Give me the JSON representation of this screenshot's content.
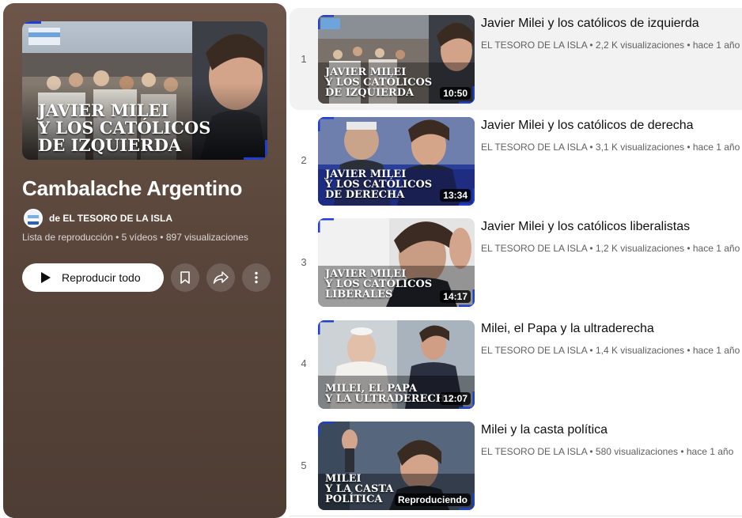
{
  "playlist": {
    "title": "Cambalache Argentino",
    "channel": "de EL TESORO DE LA ISLA",
    "meta": "Lista de reproducción • 5 vídeos • 897 visualizaciones",
    "hero_caption": [
      "JAVIER MILEI",
      "Y LOS CATÓLICOS",
      "DE IZQUIERDA"
    ],
    "play_all_label": "Reproducir todo"
  },
  "colors": {
    "panel": "#5a463b",
    "accent_blue": "#1e3fd0"
  },
  "videos": [
    {
      "index": "1",
      "title": "Javier Milei y los católicos de izquierda",
      "meta": "EL TESORO DE LA ISLA • 2,2 K visualizaciones • hace 1 año",
      "duration": "10:50",
      "caption": [
        "JAVIER MILEI",
        "Y LOS CATÓLICOS",
        "DE IZQUIERDA"
      ]
    },
    {
      "index": "2",
      "title": "Javier Milei y los católicos de derecha",
      "meta": "EL TESORO DE LA ISLA • 3,1 K visualizaciones • hace 1 año",
      "duration": "13:34",
      "caption": [
        "JAVIER MILEI",
        "Y LOS CATÓLICOS",
        "DE DERECHA"
      ]
    },
    {
      "index": "3",
      "title": "Javier Milei y los católicos liberalistas",
      "meta": "EL TESORO DE LA ISLA • 1,2 K visualizaciones • hace 1 año",
      "duration": "14:17",
      "caption": [
        "JAVIER MILEI",
        "Y LOS CATÓLICOS",
        "LIBERALES"
      ]
    },
    {
      "index": "4",
      "title": "Milei, el Papa y la ultraderecha",
      "meta": "EL TESORO DE LA ISLA • 1,4 K visualizaciones • hace 1 año",
      "duration": "12:07",
      "caption": [
        "MILEI, EL PAPA",
        "Y LA ULTRADERECHA"
      ]
    },
    {
      "index": "5",
      "title": "Milei y la casta política",
      "meta": "EL TESORO DE LA ISLA • 580 visualizaciones • hace 1 año",
      "duration": "Reproduciendo",
      "caption": [
        "MILEI",
        "Y LA CASTA",
        "POLÍTICA"
      ]
    }
  ]
}
